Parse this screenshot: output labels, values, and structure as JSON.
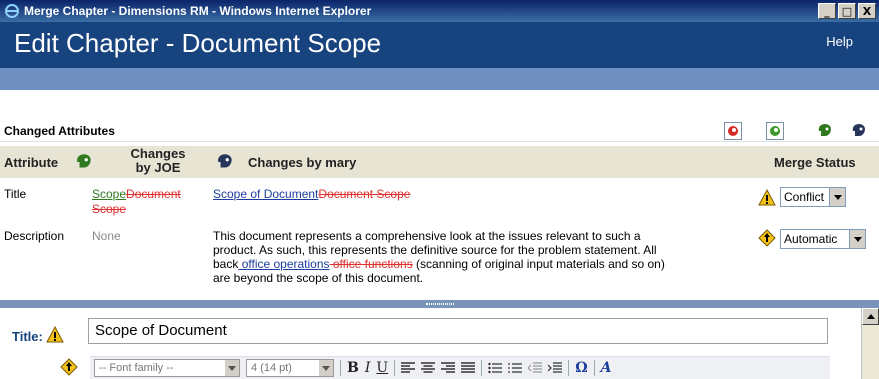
{
  "window": {
    "title": "Merge Chapter - Dimensions RM - Windows Internet Explorer",
    "minimize": "_",
    "maximize": "□",
    "close": "X"
  },
  "header": {
    "page_title": "Edit Chapter - Document Scope",
    "help": "Help"
  },
  "changed_attributes": {
    "label": "Changed Attributes"
  },
  "columns": {
    "attribute": "Attribute",
    "changes_by_joe_line1": "Changes",
    "changes_by_joe_line2": "by JOE",
    "changes_by_mary": "Changes by mary",
    "merge_status": "Merge Status"
  },
  "rows": [
    {
      "attribute": "Title",
      "joe_inserted": "Scope",
      "joe_deleted_1": "Document",
      "joe_deleted_2": "Scope",
      "mary_inserted": "Scope of Document",
      "mary_deleted": "Document Scope",
      "status": "Conflict"
    },
    {
      "attribute": "Description",
      "joe_value": "None",
      "mary_text_1": "This document represents a comprehensive look at the issues relevant to such a",
      "mary_text_2": "product. As such, this represents the definitive source for the problem statement. All",
      "mary_text_3a": "back",
      "mary_inserted": " office operations",
      "mary_deleted": " office functions",
      "mary_text_3b": " (scanning of original input materials and so on)",
      "mary_text_4": "are beyond the scope of this document.",
      "status": "Automatic"
    }
  ],
  "editor": {
    "title_label": "Title:",
    "title_value": "Scope of Document",
    "font_family": "-- Font family --",
    "font_size": "4 (14 pt)",
    "bold": "B",
    "italic": "I",
    "underline": "U",
    "omega": "Ω",
    "format_glyph": "A"
  },
  "colors": {
    "header_bg": "#17437e",
    "subbar": "#6f90c0",
    "deleted": "#e03030",
    "inserted": "#1c3d9e",
    "column_header_bg": "#e8e4d4"
  }
}
